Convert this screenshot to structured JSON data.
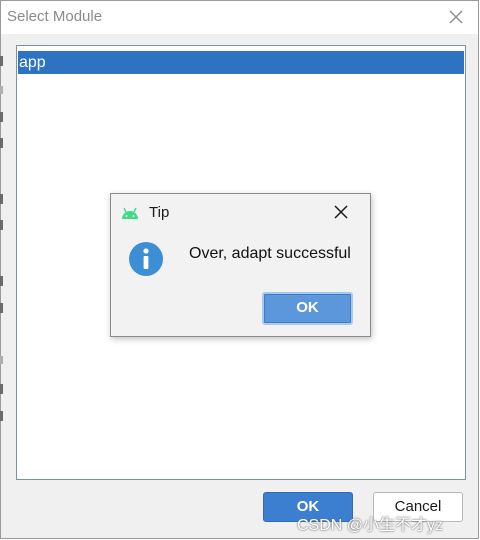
{
  "window": {
    "title": "Select Module",
    "close_icon": "close-icon"
  },
  "module_list": {
    "items": [
      {
        "label": "app",
        "selected": true
      }
    ]
  },
  "footer": {
    "ok_label": "OK",
    "cancel_label": "Cancel"
  },
  "dialog": {
    "title": "Tip",
    "app_icon": "android-icon",
    "message_icon": "info-icon",
    "message": "Over, adapt successful",
    "ok_label": "OK",
    "close_icon": "close-icon"
  },
  "watermark": "CSDN @小生不才yz",
  "colors": {
    "selection": "#2d73c2",
    "primary_button": "#3c7fd0",
    "info_icon": "#3c8fd4",
    "android_green": "#3ddc84"
  }
}
